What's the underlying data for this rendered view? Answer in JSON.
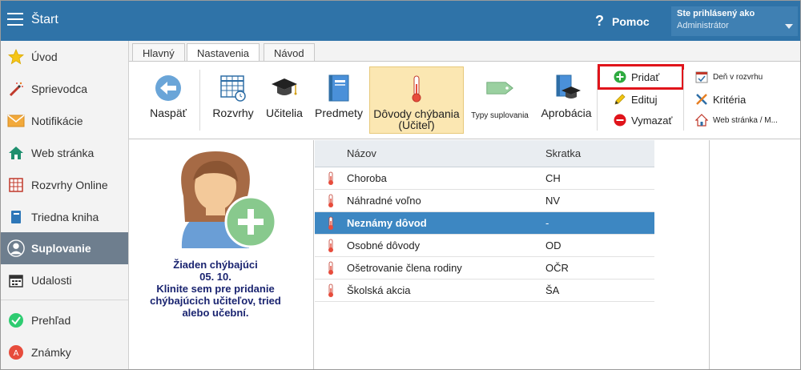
{
  "header": {
    "title": "Štart",
    "help_label": "Pomoc",
    "login_label": "Ste prihlásený ako",
    "login_user": "Administrátor"
  },
  "sidebar": {
    "items": [
      {
        "label": "Úvod",
        "icon": "star-icon"
      },
      {
        "label": "Sprievodca",
        "icon": "magic-wand-icon"
      },
      {
        "label": "Notifikácie",
        "icon": "envelope-icon"
      },
      {
        "label": "Web stránka",
        "icon": "house-icon"
      },
      {
        "label": "Rozvrhy Online",
        "icon": "timetable-icon"
      },
      {
        "label": "Triedna kniha",
        "icon": "notebook-icon"
      },
      {
        "label": "Suplovanie",
        "icon": "person-icon"
      },
      {
        "label": "Udalosti",
        "icon": "calendar-icon"
      },
      {
        "label": "Prehľad",
        "icon": "check-circle-icon"
      },
      {
        "label": "Známky",
        "icon": "grade-icon"
      }
    ],
    "active_index": 6
  },
  "tabs": [
    {
      "label": "Hlavný"
    },
    {
      "label": "Nastavenia"
    },
    {
      "label": "Návod"
    }
  ],
  "ribbon": {
    "back": "Naspäť",
    "timetables": "Rozvrhy",
    "teachers": "Učitelia",
    "subjects": "Predmety",
    "absence_reasons_l1": "Dôvody chýbania",
    "absence_reasons_l2": "(Učiteľ)",
    "substitution_types": "Typy suplovania",
    "approbation": "Aprobácia",
    "add": "Pridať",
    "edit": "Edituj",
    "delete": "Vymazať",
    "day_in_schedule": "Deň v rozvrhu",
    "criteria": "Kritéria",
    "web_page": "Web stránka / M..."
  },
  "left_panel": {
    "line1": "Žiaden chýbajúci",
    "line2": "05. 10.",
    "line3": "Klinite sem pre pridanie",
    "line4": "chýbajúcich učiteľov, tried",
    "line5": "alebo učební."
  },
  "table": {
    "col_name": "Názov",
    "col_short": "Skratka",
    "rows": [
      {
        "name": "Choroba",
        "short": "CH"
      },
      {
        "name": "Náhradné voľno",
        "short": "NV"
      },
      {
        "name": "Neznámy dôvod",
        "short": "-"
      },
      {
        "name": "Osobné dôvody",
        "short": "OD"
      },
      {
        "name": "Ošetrovanie člena rodiny",
        "short": "OČR"
      },
      {
        "name": "Školská akcia",
        "short": "ŠA"
      }
    ],
    "selected_index": 2
  },
  "colors": {
    "topbar": "#2f73a8",
    "active_sidebar": "#6e7e8e",
    "selected_row": "#3d87c2",
    "selected_ribbon": "#fbe7b2",
    "highlight": "#e0141b"
  }
}
